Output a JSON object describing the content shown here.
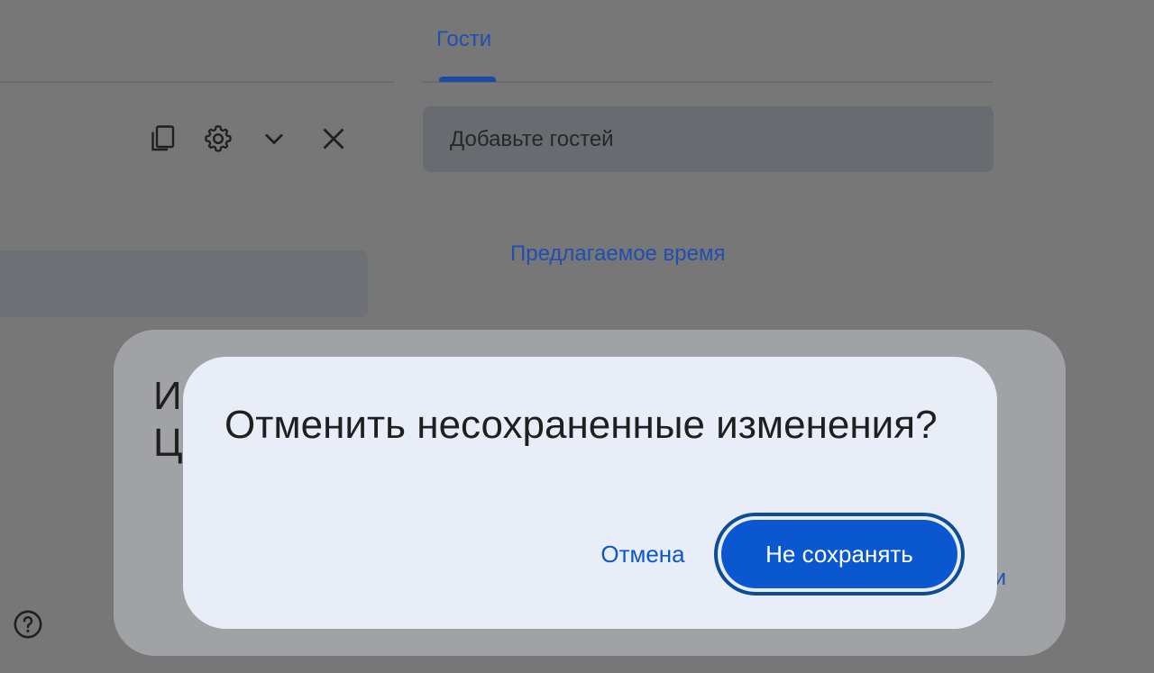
{
  "background": {
    "tab_guests": "Гости",
    "guests_input_placeholder": "Добавьте гостей",
    "suggested_time_link": "Предлагаемое время",
    "toolbar_icons": [
      "copy-icon",
      "gear-icon",
      "chevron-down-icon",
      "close-icon"
    ],
    "sheet_text_partial": [
      "И",
      "Ц"
    ],
    "sheet_link_partial": "и"
  },
  "dialog": {
    "title": "Отменить несохраненные изменения?",
    "cancel_label": "Отмена",
    "discard_label": "Не сохранять"
  },
  "colors": {
    "scrim": "#777777",
    "dialog_bg": "#e8edf7",
    "primary": "#0b57d0",
    "primary_text_link": "#0b57d0"
  }
}
